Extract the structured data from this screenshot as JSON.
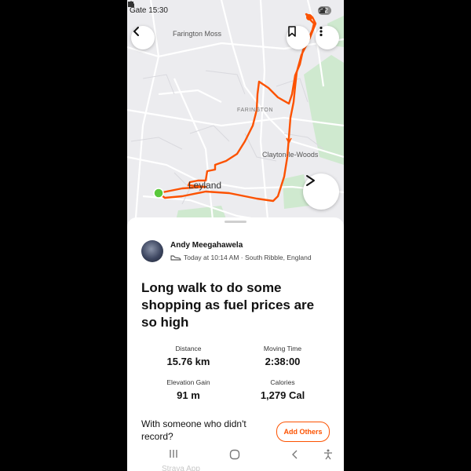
{
  "status_bar": {
    "time": "15:30",
    "prefix": "Gate",
    "battery": "52"
  },
  "map": {
    "labels": {
      "farington_moss": "Farington Moss",
      "farington": "FARINGTON",
      "clayton_le_woods": "Clayton-le-Woods",
      "leyland": "Leyland"
    },
    "route_color": "#fc5200",
    "start_marker_color": "#5ac83c"
  },
  "activity": {
    "athlete_name": "Andy Meegahawela",
    "meta": "Today at 10:14 AM · South Ribble, England",
    "title": "Long walk to do some shopping as fuel prices are so high",
    "stats": {
      "distance_label": "Distance",
      "distance_value": "15.76 km",
      "moving_time_label": "Moving Time",
      "moving_time_value": "2:38:00",
      "elevation_label": "Elevation Gain",
      "elevation_value": "91 m",
      "calories_label": "Calories",
      "calories_value": "1,279 Cal"
    },
    "prompt": "With someone who didn't record?",
    "add_others_label": "Add Others"
  },
  "nav_bar": {
    "ghost_text": "Strava App"
  },
  "colors": {
    "accent": "#fc5200"
  }
}
